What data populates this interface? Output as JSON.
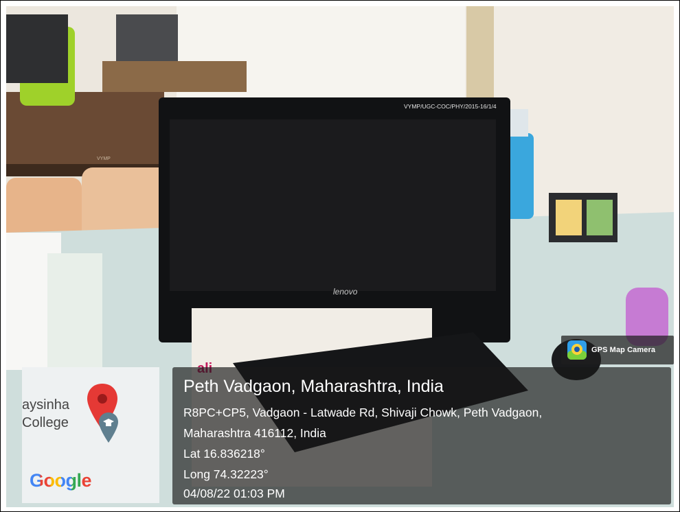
{
  "photo": {
    "monitor_label": "VYMP/UGC-COC/PHY/2015-16/1/4",
    "monitor_brand": "lenovo",
    "table_label": "VYMP",
    "newspaper_text": "ali"
  },
  "gps_badge": {
    "app_name": "GPS Map Camera"
  },
  "map": {
    "place_text_line1": "aysinha",
    "place_text_line2": "College",
    "provider": "Google",
    "pin_icon": "map-pin-icon",
    "college_icon": "graduation-cap-icon"
  },
  "location": {
    "title": "Peth Vadgaon, Maharashtra, India",
    "address_line1": "R8PC+CP5, Vadgaon - Latwade Rd, Shivaji Chowk, Peth Vadgaon,",
    "address_line2": "Maharashtra 416112, India",
    "lat": "Lat 16.836218°",
    "long": "Long 74.32223°",
    "datetime": "04/08/22 01:03 PM"
  },
  "colors": {
    "google_blue": "#4285F4",
    "google_red": "#EA4335",
    "google_yellow": "#FBBC05",
    "google_green": "#34A853",
    "pin_red": "#e53935"
  }
}
